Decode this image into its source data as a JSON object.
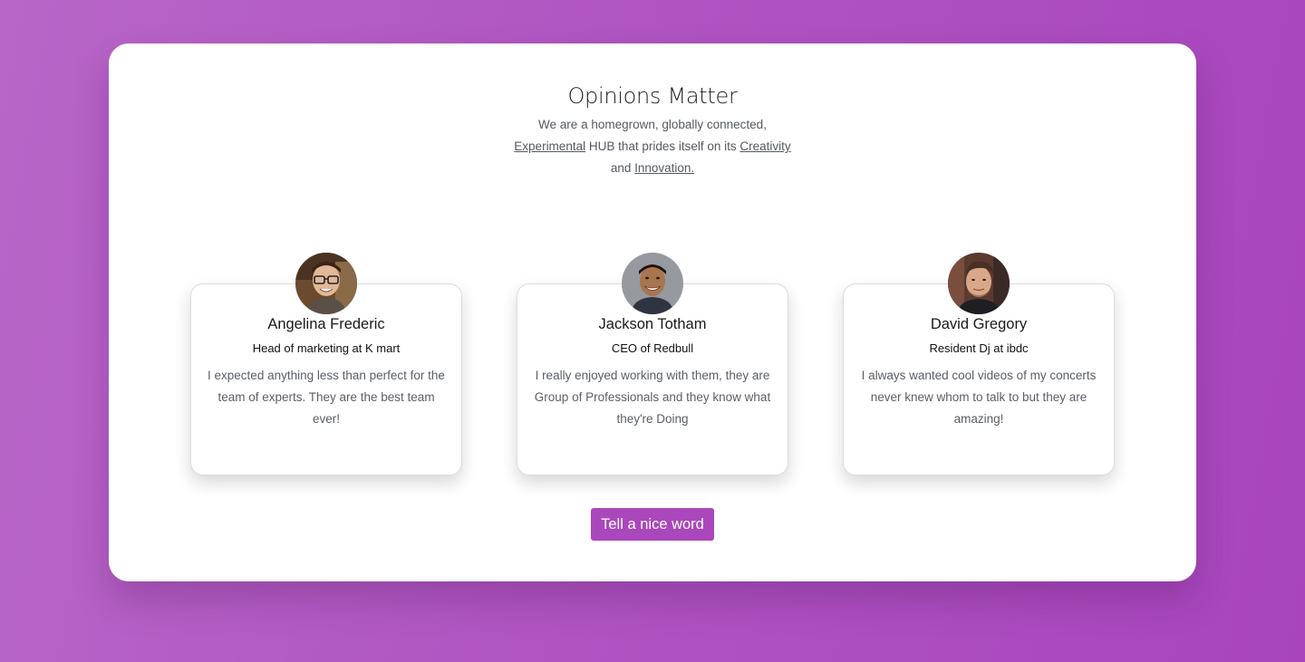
{
  "section": {
    "title": "Opinions Matter",
    "intro": {
      "line1": "We are a homegrown, globally connected,",
      "link_experimental": "Experimental",
      "mid_text": " HUB that prides itself on its ",
      "link_creativity": "Creativity",
      "and_text": "and ",
      "link_innovation": "Innovation."
    }
  },
  "testimonials": [
    {
      "name": "Angelina Frederic",
      "role": "Head of marketing at K mart",
      "quote": "I expected anything less than perfect for the team of experts. They are the best team ever!",
      "avatar_icon": "person-with-glasses-photo"
    },
    {
      "name": "Jackson Totham",
      "role": "CEO of Redbull",
      "quote": "I really enjoyed working with them, they are Group of Professionals and they know what they're Doing",
      "avatar_icon": "smiling-man-photo"
    },
    {
      "name": "David Gregory",
      "role": "Resident Dj at ibdc",
      "quote": "I always wanted cool videos of my concerts never knew whom to talk to but they are amazing!",
      "avatar_icon": "man-portrait-photo"
    }
  ],
  "cta": {
    "label": "Tell a nice word"
  },
  "colors": {
    "background_start": "#b866c8",
    "background_end": "#a845bd",
    "accent": "#ab47bc",
    "card_bg": "#ffffff"
  }
}
